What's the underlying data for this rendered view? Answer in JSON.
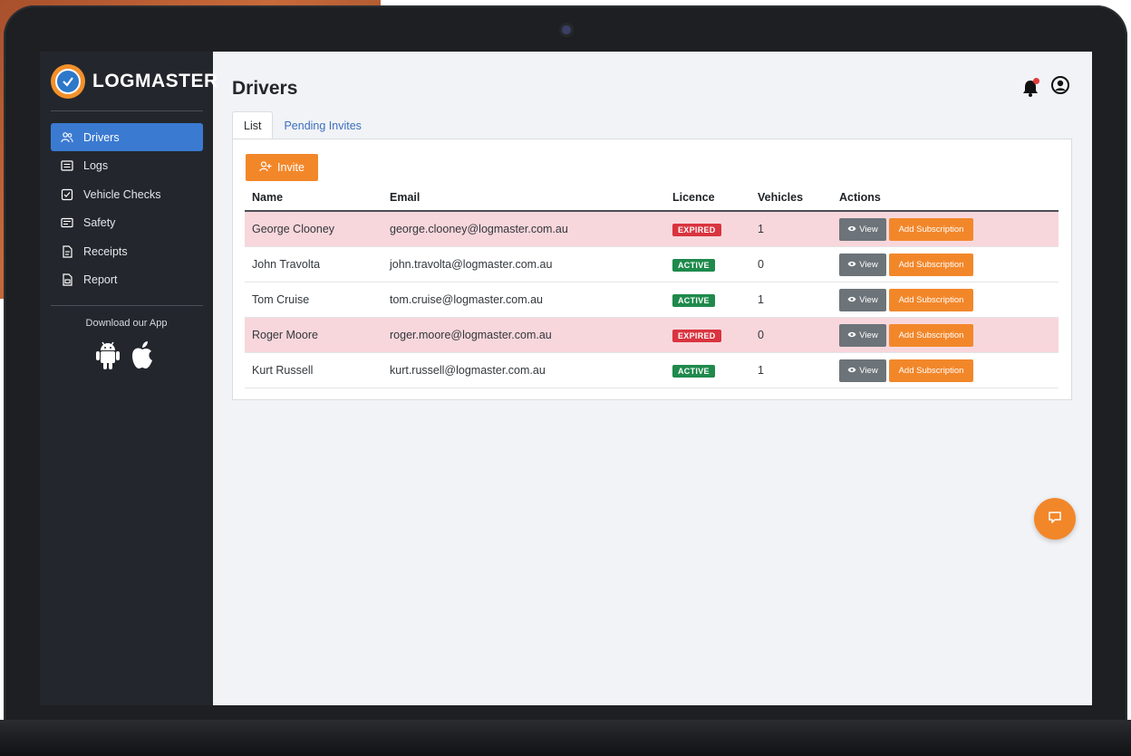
{
  "brand": {
    "name": "LOGMASTER"
  },
  "sidebar": {
    "items": [
      {
        "label": "Drivers",
        "icon": "users-icon",
        "active": true
      },
      {
        "label": "Logs",
        "icon": "list-icon",
        "active": false
      },
      {
        "label": "Vehicle Checks",
        "icon": "checkbox-icon",
        "active": false
      },
      {
        "label": "Safety",
        "icon": "card-icon",
        "active": false
      },
      {
        "label": "Receipts",
        "icon": "receipt-icon",
        "active": false
      },
      {
        "label": "Report",
        "icon": "report-icon",
        "active": false
      }
    ],
    "download_label": "Download our App",
    "store_icons": [
      "android-icon",
      "apple-icon"
    ]
  },
  "header": {
    "title": "Drivers",
    "icons": [
      "bell-icon",
      "user-circle-icon"
    ]
  },
  "tabs": [
    {
      "label": "List",
      "active": true
    },
    {
      "label": "Pending Invites",
      "active": false
    }
  ],
  "invite_button": {
    "label": "Invite"
  },
  "table": {
    "columns": [
      "Name",
      "Email",
      "Licence",
      "Vehicles",
      "Actions"
    ],
    "rows": [
      {
        "name": "George Clooney",
        "email": "george.clooney@logmaster.com.au",
        "licence": "EXPIRED",
        "vehicles": "1"
      },
      {
        "name": "John Travolta",
        "email": "john.travolta@logmaster.com.au",
        "licence": "ACTIVE",
        "vehicles": "0"
      },
      {
        "name": "Tom Cruise",
        "email": "tom.cruise@logmaster.com.au",
        "licence": "ACTIVE",
        "vehicles": "1"
      },
      {
        "name": "Roger Moore",
        "email": "roger.moore@logmaster.com.au",
        "licence": "EXPIRED",
        "vehicles": "0"
      },
      {
        "name": "Kurt Russell",
        "email": "kurt.russell@logmaster.com.au",
        "licence": "ACTIVE",
        "vehicles": "1"
      }
    ],
    "view_label": "View",
    "subscription_label": "Add Subscription"
  },
  "colors": {
    "accent": "#f2872a",
    "sidebar_bg": "#23272d",
    "active_nav": "#3b7ad1",
    "expired_badge": "#d9343f",
    "active_badge": "#1f8a4c",
    "expired_row": "#f8d7dc"
  }
}
